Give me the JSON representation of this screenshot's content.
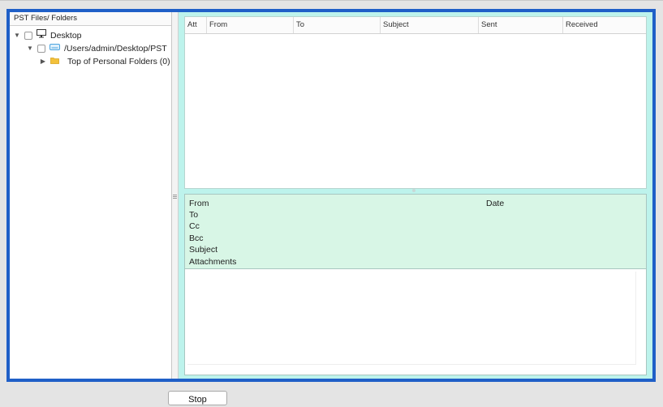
{
  "left_pane": {
    "title": "PST Files/ Folders",
    "tree": [
      {
        "label": "Desktop",
        "icon": "monitor-icon",
        "expanded": true
      },
      {
        "label": "/Users/admin/Desktop/PST",
        "icon": "drive-icon",
        "expanded": true
      },
      {
        "label": "Top of Personal Folders (0)",
        "icon": "folder-icon",
        "expanded": false
      }
    ]
  },
  "message_list": {
    "columns": [
      "Att",
      "From",
      "To",
      "Subject",
      "Sent",
      "Received"
    ],
    "rows": []
  },
  "message_header": {
    "fields": [
      "From",
      "To",
      "Cc",
      "Bcc",
      "Subject",
      "Attachments"
    ],
    "date_label": "Date"
  },
  "buttons": {
    "stop": "Stop"
  },
  "colors": {
    "frame_border": "#1f5fc7",
    "preview_background": "#bdf3ec",
    "header_background": "#d8f6e6"
  }
}
